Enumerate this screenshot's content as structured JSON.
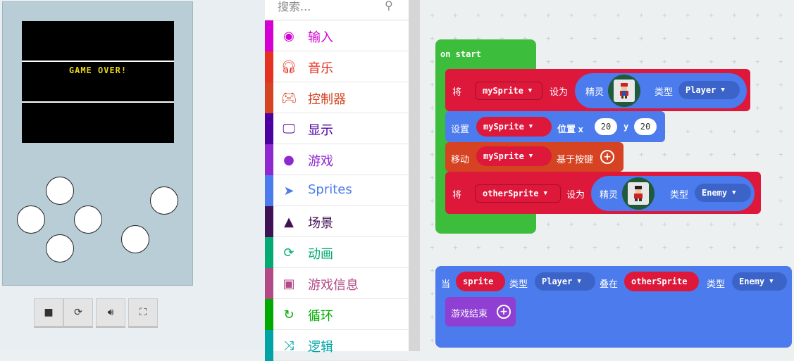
{
  "simulator": {
    "screen_text": "GAME OVER!",
    "controls": [
      "stop-icon",
      "restart-icon",
      "sound-icon",
      "fullscreen-icon"
    ]
  },
  "toolbox": {
    "search_placeholder": "搜索...",
    "categories": [
      {
        "label": "输入",
        "color": "#d400d4",
        "icon": "target-icon"
      },
      {
        "label": "音乐",
        "color": "#e63022",
        "icon": "headphones-icon"
      },
      {
        "label": "控制器",
        "color": "#d54322",
        "icon": "gamepad-icon"
      },
      {
        "label": "显示",
        "color": "#4b009f",
        "icon": "monitor-icon"
      },
      {
        "label": "游戏",
        "color": "#8f28d1",
        "icon": "circle-icon"
      },
      {
        "label": "Sprites",
        "color": "#4b7bec",
        "icon": "paper-plane-icon"
      },
      {
        "label": "场景",
        "color": "#401255",
        "icon": "tree-icon"
      },
      {
        "label": "动画",
        "color": "#03aa74",
        "icon": "refresh-icon"
      },
      {
        "label": "游戏信息",
        "color": "#b24a88",
        "icon": "id-card-icon"
      },
      {
        "label": "循环",
        "color": "#00aa00",
        "icon": "loop-icon"
      },
      {
        "label": "逻辑",
        "color": "#00a4a6",
        "icon": "shuffle-icon"
      }
    ]
  },
  "workspace": {
    "on_start": "on start",
    "set_kw": "将",
    "set_to": "设为",
    "sprite_kw": "精灵",
    "kind_kw": "类型",
    "var1": "mySprite",
    "kind1": "Player",
    "position_kw": "设置",
    "position_label": "位置 x",
    "y_label": "y",
    "x_val": "20",
    "y_val": "20",
    "move_kw": "移动",
    "move_suffix": "基于按键",
    "var2": "otherSprite",
    "kind2": "Enemy",
    "overlap_when": "当",
    "overlap_sprite": "sprite",
    "overlap_kw": "叠在",
    "overlap_other": "otherSprite",
    "game_over_block": "游戏结束"
  }
}
